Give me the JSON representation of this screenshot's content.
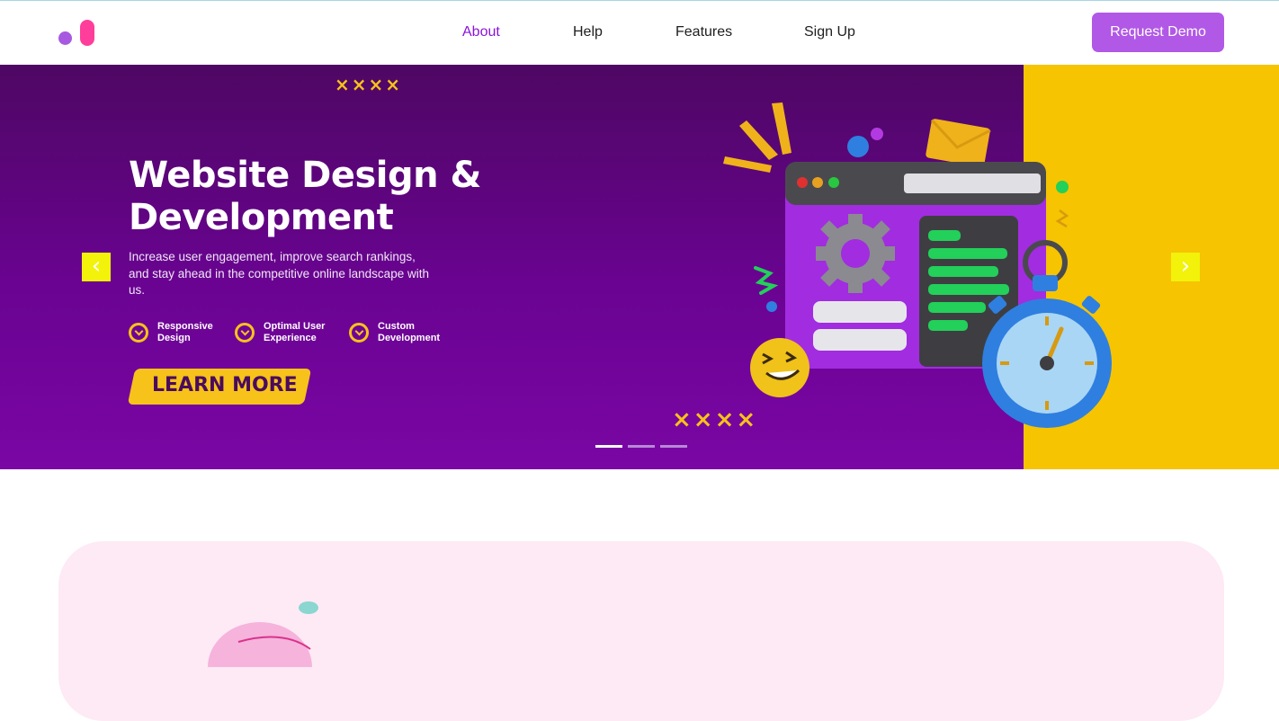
{
  "nav": {
    "links": [
      "About",
      "Help",
      "Features",
      "Sign Up"
    ],
    "active": "About",
    "cta": "Request Demo"
  },
  "hero": {
    "title": "Website Design & Development",
    "description": "Increase user engagement, improve search rankings, and stay ahead in the competitive online landscape with us.",
    "features": [
      {
        "line1": "Responsive",
        "line2": "Design"
      },
      {
        "line1": "Optimal User",
        "line2": "Experience"
      },
      {
        "line1": "Custom",
        "line2": "Development"
      }
    ],
    "cta": "LEARN MORE",
    "decor_top": "××××",
    "decor_bottom": "××××",
    "slides_active": 1,
    "slides_total": 3
  },
  "colors": {
    "brand_purple": "#b158e6",
    "active_link": "#8a14d9",
    "hero_purple": "#6a0392",
    "accent_yellow": "#f6c400",
    "logo_pink": "#ff3d9a"
  },
  "icons": [
    "logo-icon",
    "check-circle-icon",
    "chevron-left-icon",
    "chevron-right-icon"
  ]
}
